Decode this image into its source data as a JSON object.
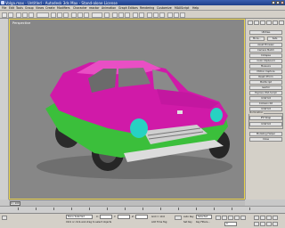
{
  "window": {
    "title": "Volga.max - Untitled - Autodesk 3ds Max - Stand-alone License"
  },
  "menu": [
    "File",
    "Edit",
    "Tools",
    "Group",
    "Views",
    "Create",
    "Modifiers",
    "Character",
    "reactor",
    "Animation",
    "Graph Editors",
    "Rendering",
    "Customize",
    "MAXScript",
    "Help"
  ],
  "viewport": {
    "label": "Perspective"
  },
  "right_panel": {
    "buttons": [
      "Utilities",
      "More...",
      "Sets",
      "Asset Browser",
      "Camera Match",
      "Collapse",
      "Color Clipboard",
      "Measure",
      "Motion Capture",
      "Reset XForm",
      "MAXScript",
      "reactor",
      "Explore VDA Script",
      "UVW Kit",
      "Collision Kit",
      "UVW Kit"
    ],
    "section": "Illumination",
    "buttons2": [
      "IFP Wrap",
      "UVW Kit",
      "Modeling Helper",
      "Close"
    ]
  },
  "timeline": {
    "slider": "0 / 100"
  },
  "statusbar": {
    "selected": "None Selected",
    "prompt": "Click or click-and-drag to select objects",
    "x_label": "X:",
    "y_label": "Y:",
    "z_label": "Z:",
    "grid": "Grid = 10.0",
    "auto_key": "Auto Key",
    "set_key": "Set Key",
    "key_filter": "Selected",
    "key_filters_btn": "Key Filters...",
    "add_time_tag": "Add Time Tag",
    "frame": "0"
  },
  "colors": {
    "car_body": "#d01aa8",
    "car_green": "#3bbf3b",
    "headlight": "#27d2c2",
    "viewport": "#878787",
    "title": "#2a4fa0"
  }
}
